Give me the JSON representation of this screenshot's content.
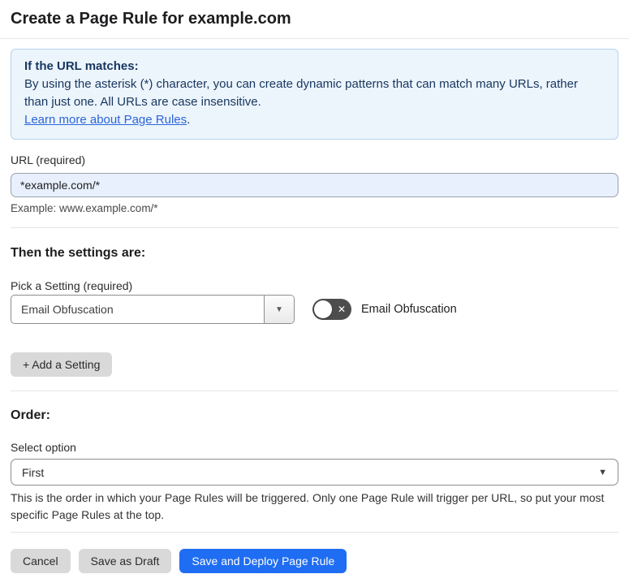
{
  "page": {
    "title": "Create a Page Rule for example.com"
  },
  "info_box": {
    "heading": "If the URL matches:",
    "body": "By using the asterisk (*) character, you can create dynamic patterns that can match many URLs, rather than just one. All URLs are case insensitive.",
    "link_label": "Learn more about Page Rules",
    "link_suffix": "."
  },
  "url_field": {
    "label": "URL (required)",
    "value": "*example.com/*",
    "example": "Example: www.example.com/*"
  },
  "settings_section": {
    "heading": "Then the settings are:",
    "setting_label": "Pick a Setting (required)",
    "setting_value": "Email Obfuscation",
    "toggle_label": "Email Obfuscation",
    "toggle_state": "off",
    "add_setting_label": "+ Add a Setting"
  },
  "order_section": {
    "heading": "Order:",
    "select_label": "Select option",
    "select_value": "First",
    "help_text": "This is the order in which your Page Rules will be triggered. Only one Page Rule will trigger per URL, so put your most specific Page Rules at the top."
  },
  "footer": {
    "cancel_label": "Cancel",
    "save_draft_label": "Save as Draft",
    "save_deploy_label": "Save and Deploy Page Rule"
  },
  "icons": {
    "dropdown_arrow": "▼",
    "toggle_x": "✕"
  },
  "colors": {
    "accent_blue": "#1f6df2",
    "info_background": "#ecf4fc",
    "info_border": "#b7d3ef",
    "info_text": "#17365e",
    "link_blue": "#2b65d9",
    "input_background": "#e8f0fe",
    "toggle_background": "#4d4d4d",
    "gray_button": "#d9d9d9"
  }
}
